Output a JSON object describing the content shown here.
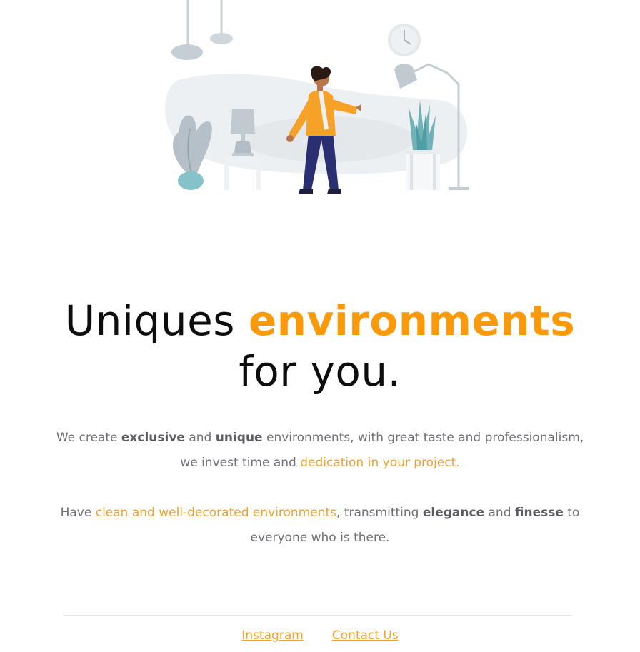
{
  "headline": {
    "part1": "Uniques ",
    "accent": "environments",
    "part2": "for you."
  },
  "paragraph1": {
    "t1": "We create ",
    "b1": "exclusive",
    "t2": " and ",
    "b2": "unique",
    "t3": " environments, with great taste and professionalism, we invest time and ",
    "hl": "dedication in your project."
  },
  "paragraph2": {
    "t1": "Have ",
    "hl": "clean and well-decorated environments",
    "t2": ", transmitting ",
    "b1": "elegance",
    "t3": " and ",
    "b2": "finesse",
    "t4": " to everyone who is there."
  },
  "footer": {
    "instagram": "Instagram",
    "contact": "Contact Us"
  },
  "colors": {
    "accent": "#fa9a0b",
    "text": "#6f6f78",
    "heading": "#0d0d0d"
  },
  "illustration": {
    "icons": [
      "pendant-lamp-icon",
      "wall-clock-icon",
      "plant-icon",
      "table-lamp-icon",
      "person-icon",
      "floor-lamp-icon",
      "succulent-icon"
    ]
  }
}
